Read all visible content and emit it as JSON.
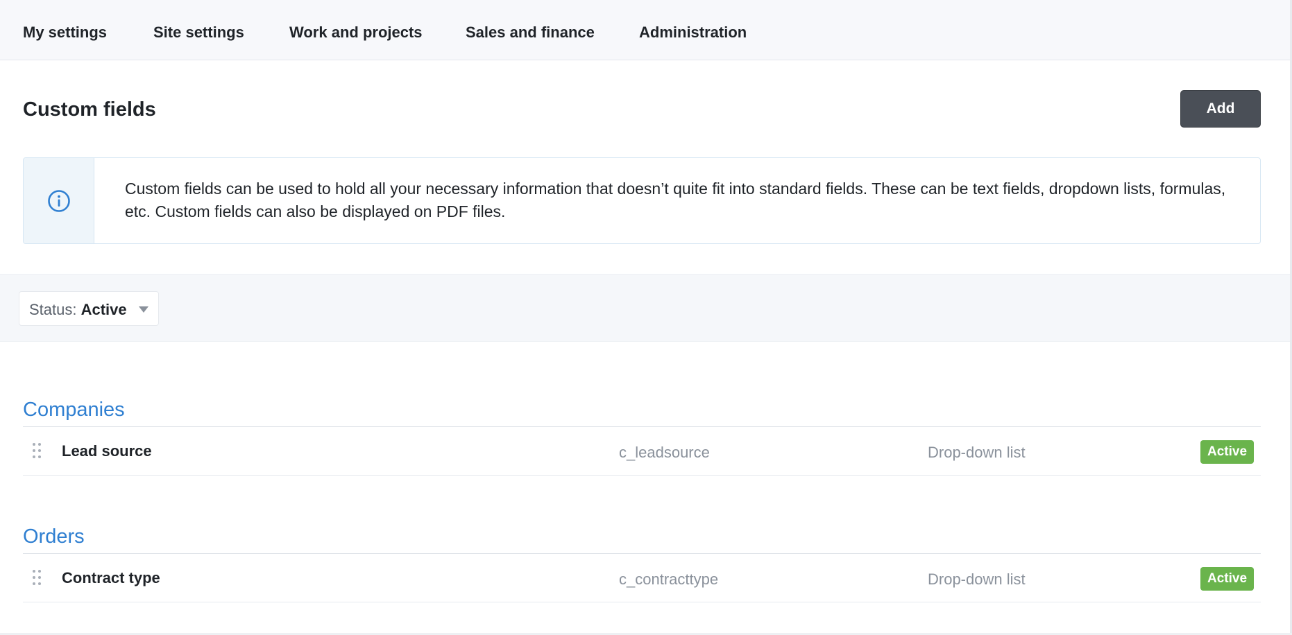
{
  "nav": {
    "tabs": [
      {
        "label": "My settings"
      },
      {
        "label": "Site settings"
      },
      {
        "label": "Work and projects"
      },
      {
        "label": "Sales and finance"
      },
      {
        "label": "Administration"
      }
    ]
  },
  "header": {
    "title": "Custom fields",
    "add_label": "Add"
  },
  "info": {
    "icon": "info-circle-icon",
    "text": "Custom fields can be used to hold all your necessary information that doesn’t quite fit into standard fields. These can be text fields, dropdown lists, formulas, etc. Custom fields can also be displayed on PDF files."
  },
  "filter": {
    "label": "Status:",
    "value": "Active",
    "icon": "caret-down-icon"
  },
  "sections": [
    {
      "title": "Companies",
      "rows": [
        {
          "name": "Lead source",
          "key": "c_leadsource",
          "type": "Drop-down list",
          "status": "Active"
        }
      ]
    },
    {
      "title": "Orders",
      "rows": [
        {
          "name": "Contract type",
          "key": "c_contracttype",
          "type": "Drop-down list",
          "status": "Active"
        }
      ]
    }
  ],
  "colors": {
    "accent": "#2f7fd1",
    "active_badge": "#6ab44c",
    "primary_button": "#4a4f57",
    "nav_background": "#f7f8fb"
  }
}
